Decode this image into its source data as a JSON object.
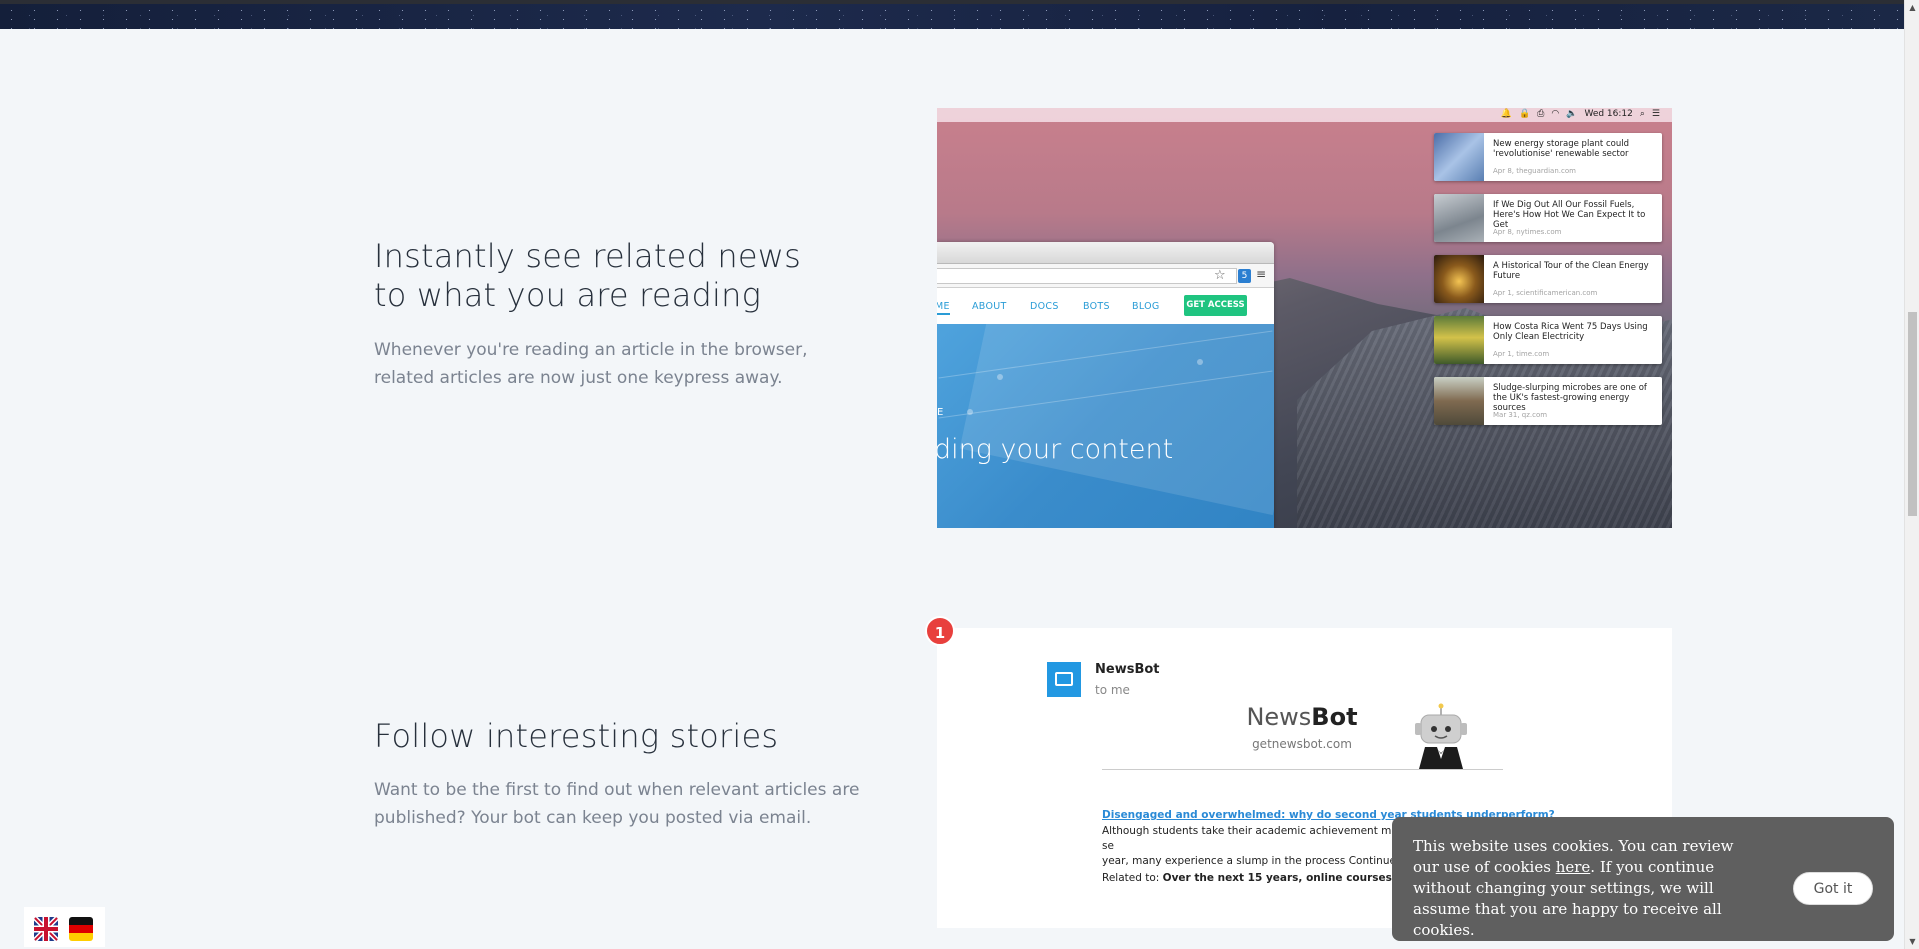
{
  "section1": {
    "heading_line1": "Instantly see related news",
    "heading_line2": "to what you are reading",
    "para_line1": "Whenever you're reading an article in the browser,",
    "para_line2": "related articles are now just one keypress away."
  },
  "section2": {
    "heading": "Follow interesting stories",
    "para_line1": "Want to be the first to find out when relevant articles are",
    "para_line2": "published? Your bot can keep you posted via email."
  },
  "mac_menubar": {
    "time": "Wed 16:12"
  },
  "browser": {
    "extension_badge": "5",
    "nav": [
      "ME",
      "ABOUT",
      "DOCS",
      "BOTS",
      "BLOG"
    ],
    "cta": "GET ACCESS",
    "hero_small": "E",
    "hero_big": "ding your content"
  },
  "news_items": [
    {
      "title": "New energy storage plant could 'revolutionise' renewable sector",
      "meta": "Apr 8, theguardian.com"
    },
    {
      "title": "If We Dig Out All Our Fossil Fuels, Here's How Hot We Can Expect It to Get",
      "meta": "Apr 8, nytimes.com"
    },
    {
      "title": "A Historical Tour of the Clean Energy Future",
      "meta": "Apr 1, scientificamerican.com"
    },
    {
      "title": "How Costa Rica Went 75 Days Using Only Clean Electricity",
      "meta": "Apr 1, time.com"
    },
    {
      "title": "Sludge-slurping microbes are one of the UK's fastest-growing energy sources",
      "meta": "Mar 31, qz.com"
    }
  ],
  "email": {
    "notification_count": "1",
    "sender": "NewsBot",
    "recipient": "to me",
    "logo_part1": "News",
    "logo_part2": "Bot",
    "logo_url": "getnewsbot.com",
    "article_link": "Disengaged and overwhelmed: why do second year students underperform?",
    "article_body_line1": "Although students take their academic achievement more se",
    "article_body_line2": "year, many experience a slump in the process Continue... –",
    "related_label": "Related to:",
    "related_value": "Over the next 15 years, online courses",
    "related_suffix": "..."
  },
  "cookie": {
    "text_before": "This website uses cookies. You can review our use of cookies ",
    "link": "here",
    "text_after": ". If you continue without changing your settings, we will assume that you are happy to receive all cookies.",
    "button": "Got it"
  },
  "colors": {
    "accent_blue": "#2a9cd6",
    "cta_green": "#1fc480",
    "badge_red": "#e8403d",
    "cookie_bg": "#5f5f5f"
  }
}
